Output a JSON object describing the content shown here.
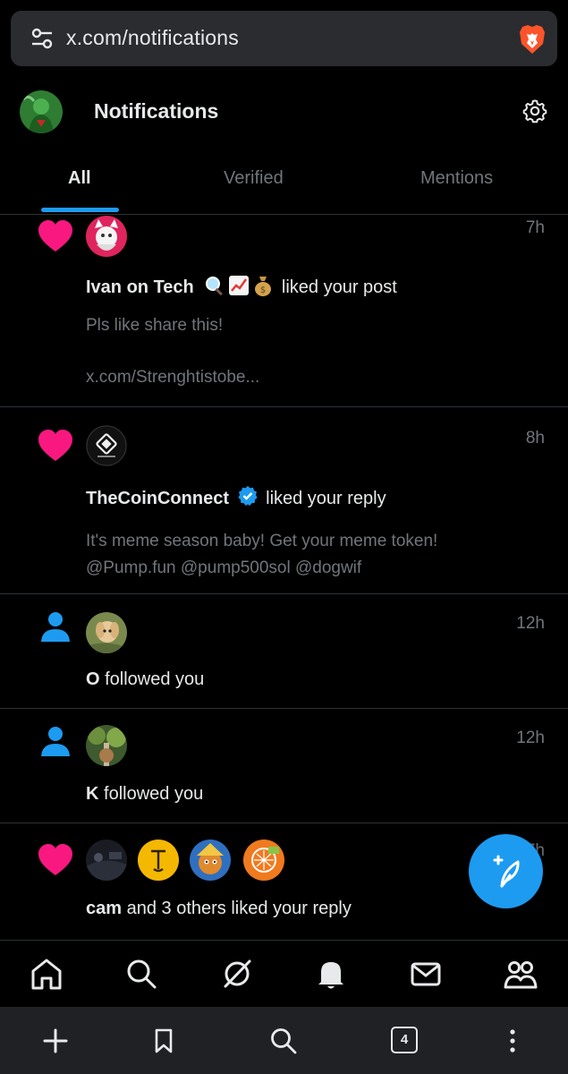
{
  "browser": {
    "url": "x.com/notifications",
    "tabs_count": "4"
  },
  "header": {
    "title": "Notifications",
    "tabs": [
      {
        "label": "All",
        "active": true
      },
      {
        "label": "Verified",
        "active": false
      },
      {
        "label": "Mentions",
        "active": false
      }
    ]
  },
  "notifications": [
    {
      "type": "like",
      "time": "7h",
      "name": "Ivan on Tech",
      "action": " liked your post",
      "text_lines": [
        "Pls like share this!",
        "",
        "x.com/Strenghtistobe..."
      ]
    },
    {
      "type": "like",
      "time": "8h",
      "name": "TheCoinConnect",
      "verified": true,
      "action": " liked your reply",
      "text_lines": [
        "It's meme season baby! Get your meme token!",
        "@Pump.fun @pump500sol  @dogwif"
      ]
    },
    {
      "type": "follow",
      "time": "12h",
      "name": "O",
      "action": " followed you"
    },
    {
      "type": "follow",
      "time": "12h",
      "name": "K",
      "action": " followed you"
    },
    {
      "type": "like",
      "time": "17h",
      "name": "cam",
      "action": " and 3 others liked your reply"
    }
  ],
  "colors": {
    "accent": "#1d9bf0",
    "like": "#f91880",
    "muted": "#71767b",
    "background": "#000000"
  },
  "icons": {
    "bottom_nav": [
      "home-icon",
      "search-icon",
      "grok-icon",
      "notifications-icon",
      "messages-icon",
      "communities-icon"
    ],
    "browser_bar": [
      "new-tab-icon",
      "bookmark-icon",
      "search-icon",
      "tabs-icon",
      "more-icon"
    ]
  }
}
